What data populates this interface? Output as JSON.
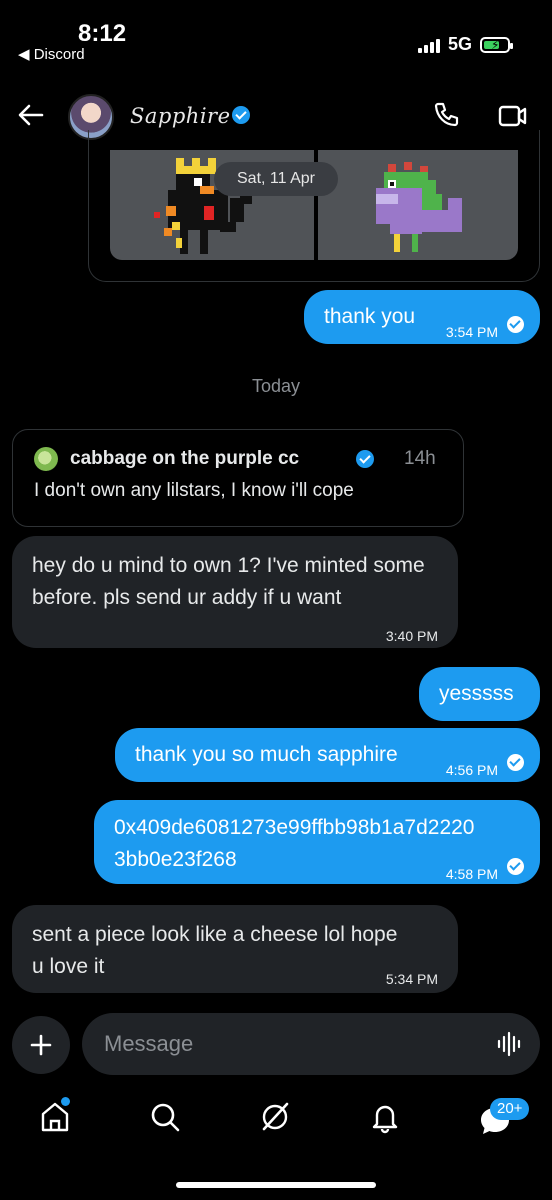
{
  "status_bar": {
    "time": "8:12",
    "back_app": "◀ Discord",
    "network": "5G"
  },
  "header": {
    "name": "Sapphire"
  },
  "shared_media": {
    "date_label": "Sat, 11 Apr"
  },
  "messages": [
    {
      "text": "thank you",
      "time": "3:54 PM",
      "direction": "out"
    },
    {
      "text": "hey do u mind to own 1? I've minted some before. pls send ur addy if u want",
      "time": "3:40 PM",
      "direction": "in"
    },
    {
      "text": "yesssss",
      "direction": "out"
    },
    {
      "text": "thank you so much sapphire",
      "time": "4:56 PM",
      "direction": "out"
    },
    {
      "text_line1": "0x409de6081273e99ffbb98b1a7d2220",
      "text_line2": "3bb0e23f268",
      "time": "4:58 PM",
      "direction": "out"
    },
    {
      "text_line1": "sent a piece look like a cheese lol hope",
      "text_line2": "u love it",
      "time": "5:34 PM",
      "direction": "in"
    }
  ],
  "day_separator": "Today",
  "quoted_post": {
    "author": "cabbage on the purple cc",
    "time": "14h",
    "text": "I don't own any lilstars, I know i'll cope"
  },
  "composer": {
    "placeholder": "Message"
  },
  "nav": {
    "messages_badge": "20+"
  },
  "colors": {
    "accent": "#1d9bf0",
    "incoming_bubble": "#202327",
    "background": "#000000"
  }
}
